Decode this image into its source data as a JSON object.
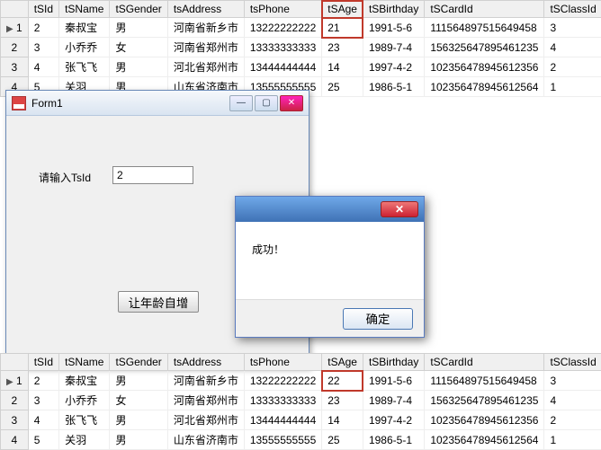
{
  "columns": [
    "tSId",
    "tSName",
    "tSGender",
    "tsAddress",
    "tsPhone",
    "tSAge",
    "tSBirthday",
    "tSCardId",
    "tSClassId"
  ],
  "top_rows": [
    {
      "n": "1",
      "ptr": true,
      "c": [
        "2",
        "秦叔宝",
        "男",
        "河南省新乡市",
        "13222222222",
        "21",
        "1991-5-6",
        "111564897515649458",
        "3"
      ]
    },
    {
      "n": "2",
      "c": [
        "3",
        "小乔乔",
        "女",
        "河南省郑州市",
        "13333333333",
        "23",
        "1989-7-4",
        "156325647895461235",
        "4"
      ]
    },
    {
      "n": "3",
      "c": [
        "4",
        "张飞飞",
        "男",
        "河北省郑州市",
        "13444444444",
        "14",
        "1997-4-2",
        "102356478945612356",
        "2"
      ]
    },
    {
      "n": "4",
      "cut": true,
      "c": [
        "5",
        "关羽",
        "男",
        "山东省济南市",
        "13555555555",
        "25",
        "1986-5-1",
        "102356478945612564",
        "1"
      ]
    }
  ],
  "bottom_rows": [
    {
      "n": "1",
      "ptr": true,
      "c": [
        "2",
        "秦叔宝",
        "男",
        "河南省新乡市",
        "13222222222",
        "22",
        "1991-5-6",
        "111564897515649458",
        "3"
      ]
    },
    {
      "n": "2",
      "c": [
        "3",
        "小乔乔",
        "女",
        "河南省郑州市",
        "13333333333",
        "23",
        "1989-7-4",
        "156325647895461235",
        "4"
      ]
    },
    {
      "n": "3",
      "c": [
        "4",
        "张飞飞",
        "男",
        "河北省郑州市",
        "13444444444",
        "14",
        "1997-4-2",
        "102356478945612356",
        "2"
      ]
    },
    {
      "n": "4",
      "c": [
        "5",
        "关羽",
        "男",
        "山东省济南市",
        "13555555555",
        "25",
        "1986-5-1",
        "102356478945612564",
        "1"
      ]
    }
  ],
  "highlight_col_index": 5,
  "form": {
    "title": "Form1",
    "label": "请输入TsId",
    "input_value": "2",
    "button": "让年龄自增"
  },
  "msg": {
    "text": "成功！",
    "ok": "确定"
  }
}
